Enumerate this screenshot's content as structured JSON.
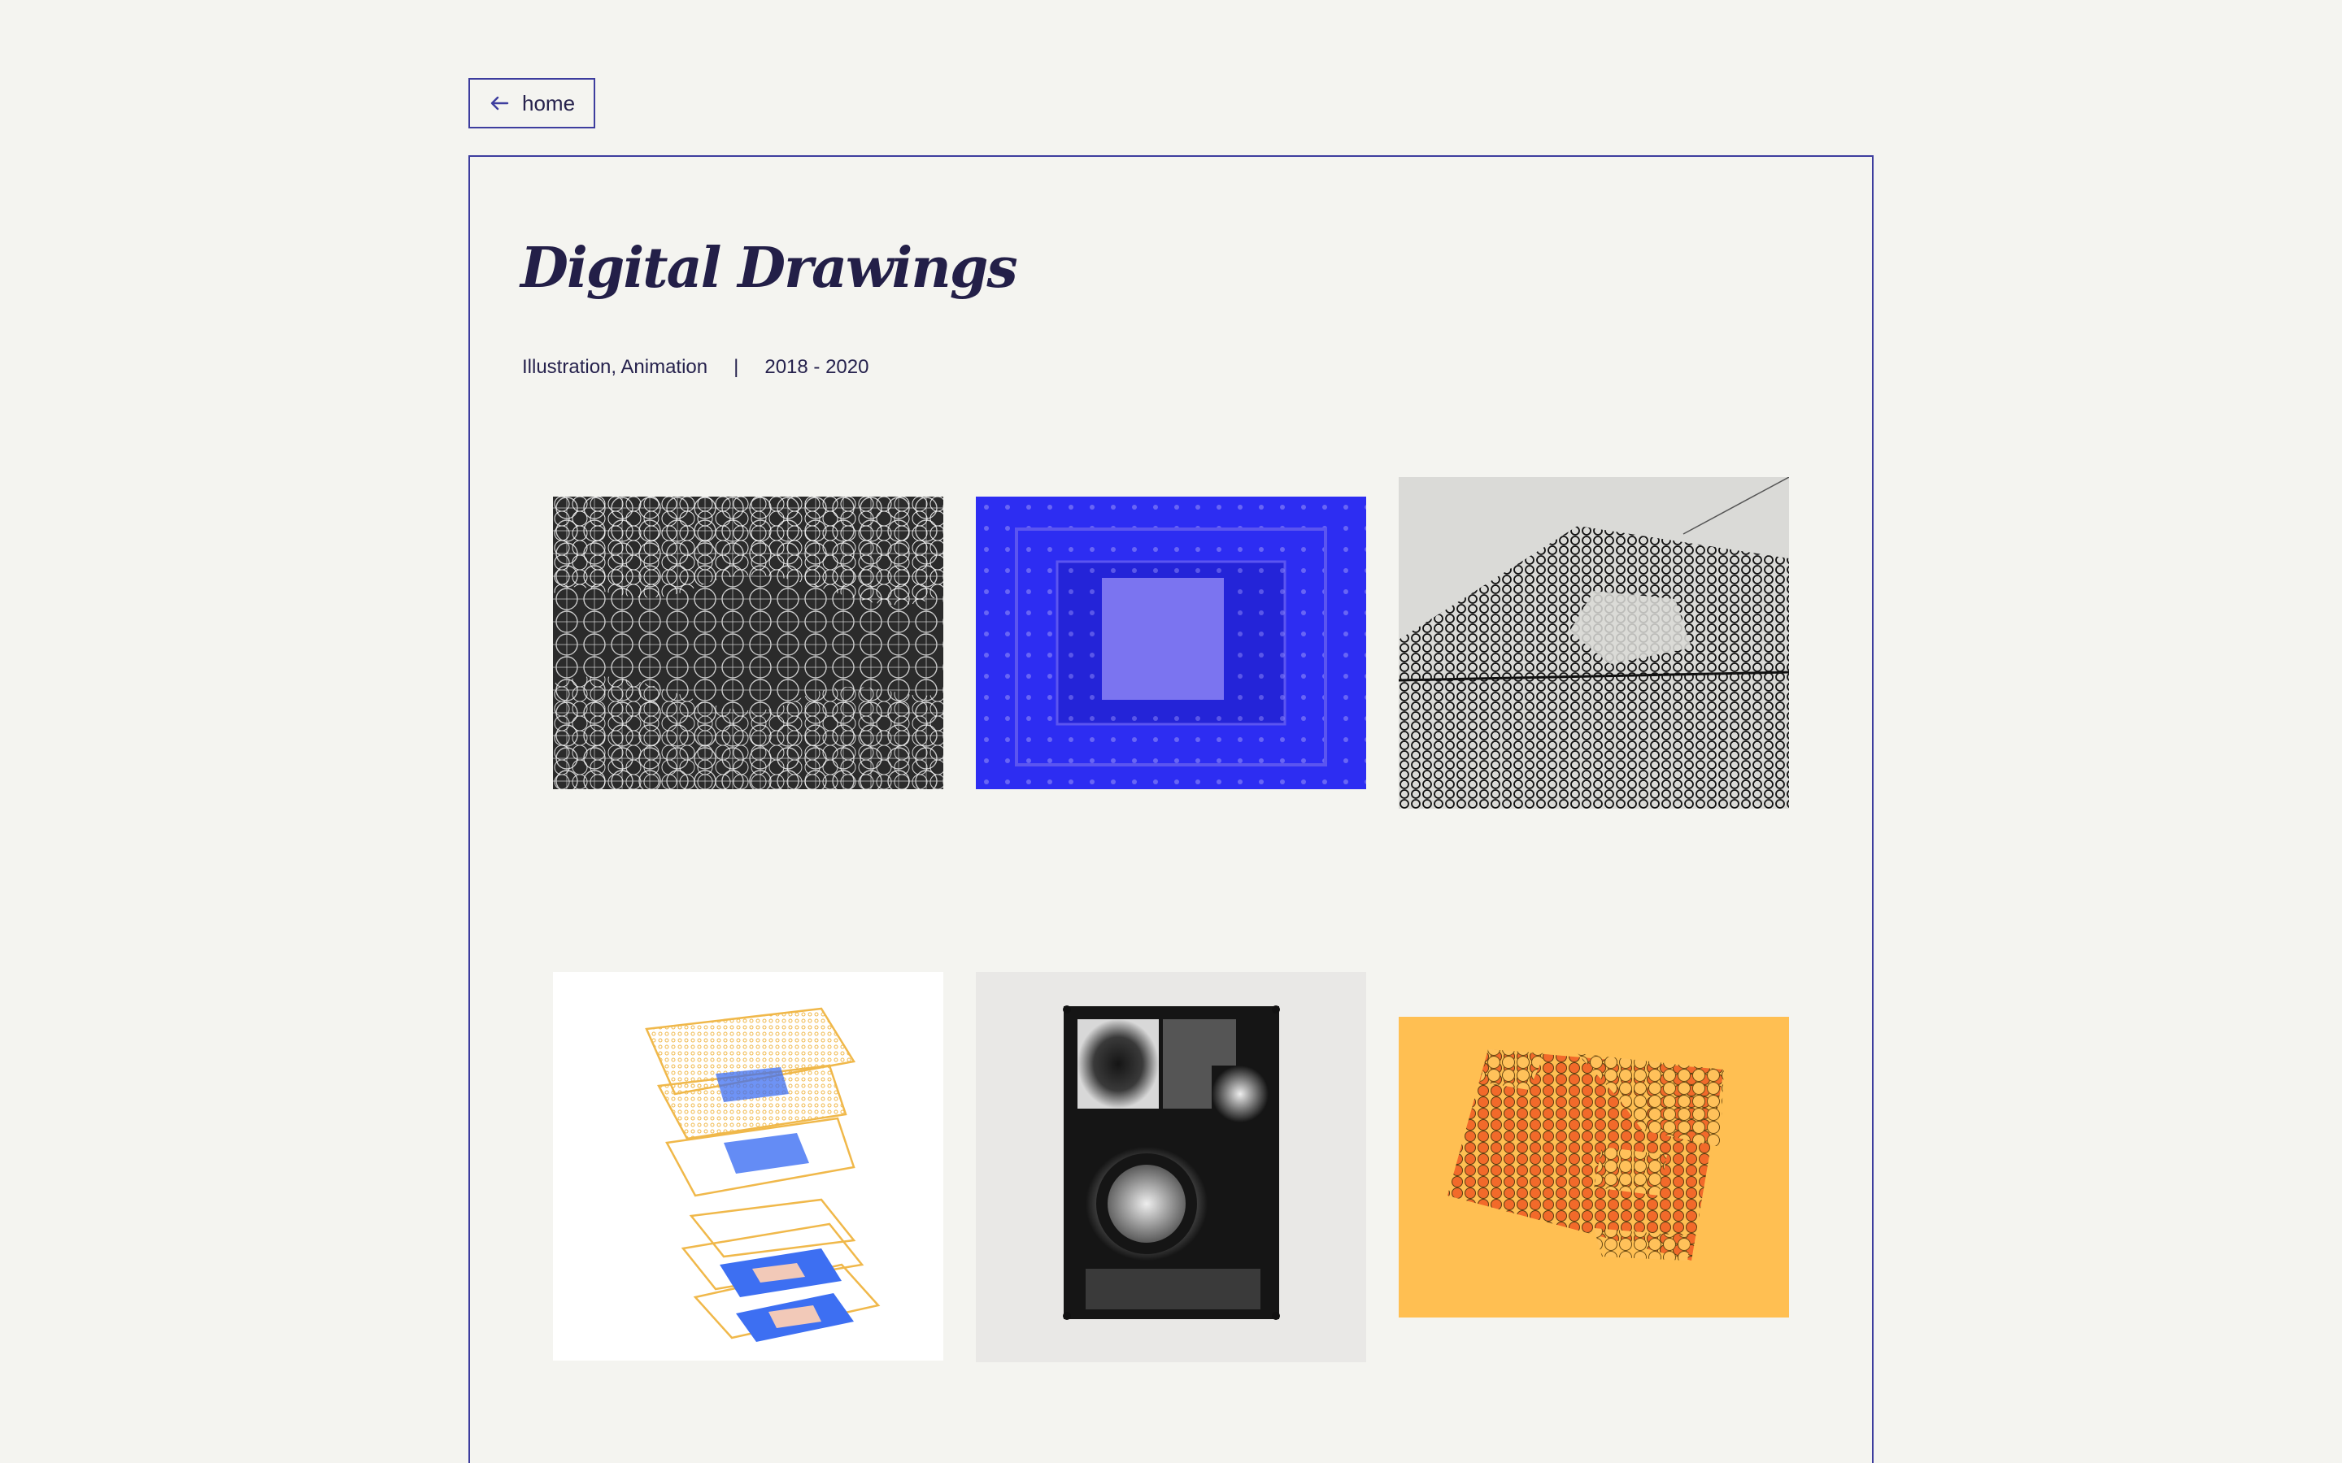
{
  "nav": {
    "home_label": "home"
  },
  "project": {
    "title": "Digital Drawings",
    "categories": "Illustration, Animation",
    "separator": "|",
    "years": "2018 - 2020"
  },
  "gallery": {
    "items": [
      {
        "subject": "white circle mesh on black",
        "colors": [
          "#2b2b2b",
          "#ffffff"
        ]
      },
      {
        "subject": "nested squares on blue",
        "colors": [
          "#2d2df2",
          "#7b74f0"
        ]
      },
      {
        "subject": "perspective black grid on grey",
        "colors": [
          "#d9d9d6",
          "#111111"
        ]
      },
      {
        "subject": "exploded layered isometric grids",
        "colors": [
          "#ffffff",
          "#f0b84a",
          "#3d6ff2"
        ]
      },
      {
        "subject": "black print hung on wall",
        "colors": [
          "#e9e8e6",
          "#151515"
        ]
      },
      {
        "subject": "orange circles on yellow",
        "colors": [
          "#ffbf52",
          "#f26a2a"
        ]
      }
    ]
  },
  "colors": {
    "background": "#f4f4f0",
    "accent": "#3d3d9e",
    "text": "#26224d"
  }
}
